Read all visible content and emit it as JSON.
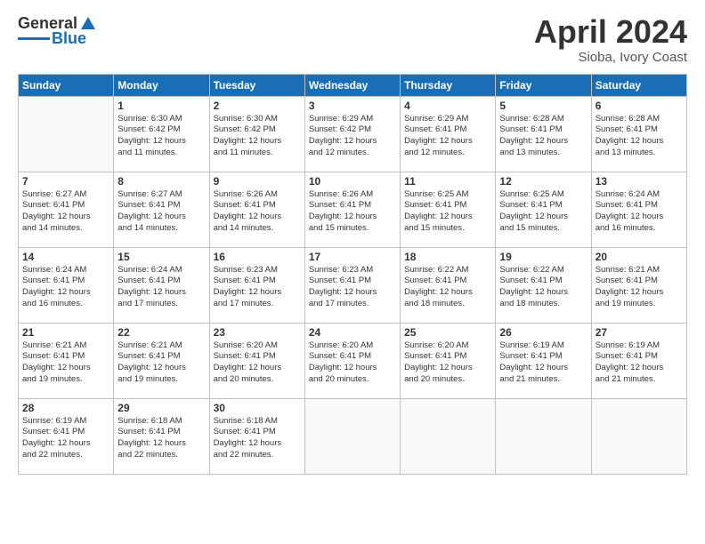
{
  "header": {
    "logo_general": "General",
    "logo_blue": "Blue",
    "title": "April 2024",
    "subtitle": "Sioba, Ivory Coast"
  },
  "days_of_week": [
    "Sunday",
    "Monday",
    "Tuesday",
    "Wednesday",
    "Thursday",
    "Friday",
    "Saturday"
  ],
  "weeks": [
    [
      {
        "day": "",
        "info": ""
      },
      {
        "day": "1",
        "info": "Sunrise: 6:30 AM\nSunset: 6:42 PM\nDaylight: 12 hours\nand 11 minutes."
      },
      {
        "day": "2",
        "info": "Sunrise: 6:30 AM\nSunset: 6:42 PM\nDaylight: 12 hours\nand 11 minutes."
      },
      {
        "day": "3",
        "info": "Sunrise: 6:29 AM\nSunset: 6:42 PM\nDaylight: 12 hours\nand 12 minutes."
      },
      {
        "day": "4",
        "info": "Sunrise: 6:29 AM\nSunset: 6:41 PM\nDaylight: 12 hours\nand 12 minutes."
      },
      {
        "day": "5",
        "info": "Sunrise: 6:28 AM\nSunset: 6:41 PM\nDaylight: 12 hours\nand 13 minutes."
      },
      {
        "day": "6",
        "info": "Sunrise: 6:28 AM\nSunset: 6:41 PM\nDaylight: 12 hours\nand 13 minutes."
      }
    ],
    [
      {
        "day": "7",
        "info": "Sunrise: 6:27 AM\nSunset: 6:41 PM\nDaylight: 12 hours\nand 14 minutes."
      },
      {
        "day": "8",
        "info": "Sunrise: 6:27 AM\nSunset: 6:41 PM\nDaylight: 12 hours\nand 14 minutes."
      },
      {
        "day": "9",
        "info": "Sunrise: 6:26 AM\nSunset: 6:41 PM\nDaylight: 12 hours\nand 14 minutes."
      },
      {
        "day": "10",
        "info": "Sunrise: 6:26 AM\nSunset: 6:41 PM\nDaylight: 12 hours\nand 15 minutes."
      },
      {
        "day": "11",
        "info": "Sunrise: 6:25 AM\nSunset: 6:41 PM\nDaylight: 12 hours\nand 15 minutes."
      },
      {
        "day": "12",
        "info": "Sunrise: 6:25 AM\nSunset: 6:41 PM\nDaylight: 12 hours\nand 15 minutes."
      },
      {
        "day": "13",
        "info": "Sunrise: 6:24 AM\nSunset: 6:41 PM\nDaylight: 12 hours\nand 16 minutes."
      }
    ],
    [
      {
        "day": "14",
        "info": "Sunrise: 6:24 AM\nSunset: 6:41 PM\nDaylight: 12 hours\nand 16 minutes."
      },
      {
        "day": "15",
        "info": "Sunrise: 6:24 AM\nSunset: 6:41 PM\nDaylight: 12 hours\nand 17 minutes."
      },
      {
        "day": "16",
        "info": "Sunrise: 6:23 AM\nSunset: 6:41 PM\nDaylight: 12 hours\nand 17 minutes."
      },
      {
        "day": "17",
        "info": "Sunrise: 6:23 AM\nSunset: 6:41 PM\nDaylight: 12 hours\nand 17 minutes."
      },
      {
        "day": "18",
        "info": "Sunrise: 6:22 AM\nSunset: 6:41 PM\nDaylight: 12 hours\nand 18 minutes."
      },
      {
        "day": "19",
        "info": "Sunrise: 6:22 AM\nSunset: 6:41 PM\nDaylight: 12 hours\nand 18 minutes."
      },
      {
        "day": "20",
        "info": "Sunrise: 6:21 AM\nSunset: 6:41 PM\nDaylight: 12 hours\nand 19 minutes."
      }
    ],
    [
      {
        "day": "21",
        "info": "Sunrise: 6:21 AM\nSunset: 6:41 PM\nDaylight: 12 hours\nand 19 minutes."
      },
      {
        "day": "22",
        "info": "Sunrise: 6:21 AM\nSunset: 6:41 PM\nDaylight: 12 hours\nand 19 minutes."
      },
      {
        "day": "23",
        "info": "Sunrise: 6:20 AM\nSunset: 6:41 PM\nDaylight: 12 hours\nand 20 minutes."
      },
      {
        "day": "24",
        "info": "Sunrise: 6:20 AM\nSunset: 6:41 PM\nDaylight: 12 hours\nand 20 minutes."
      },
      {
        "day": "25",
        "info": "Sunrise: 6:20 AM\nSunset: 6:41 PM\nDaylight: 12 hours\nand 20 minutes."
      },
      {
        "day": "26",
        "info": "Sunrise: 6:19 AM\nSunset: 6:41 PM\nDaylight: 12 hours\nand 21 minutes."
      },
      {
        "day": "27",
        "info": "Sunrise: 6:19 AM\nSunset: 6:41 PM\nDaylight: 12 hours\nand 21 minutes."
      }
    ],
    [
      {
        "day": "28",
        "info": "Sunrise: 6:19 AM\nSunset: 6:41 PM\nDaylight: 12 hours\nand 22 minutes."
      },
      {
        "day": "29",
        "info": "Sunrise: 6:18 AM\nSunset: 6:41 PM\nDaylight: 12 hours\nand 22 minutes."
      },
      {
        "day": "30",
        "info": "Sunrise: 6:18 AM\nSunset: 6:41 PM\nDaylight: 12 hours\nand 22 minutes."
      },
      {
        "day": "",
        "info": ""
      },
      {
        "day": "",
        "info": ""
      },
      {
        "day": "",
        "info": ""
      },
      {
        "day": "",
        "info": ""
      }
    ]
  ]
}
